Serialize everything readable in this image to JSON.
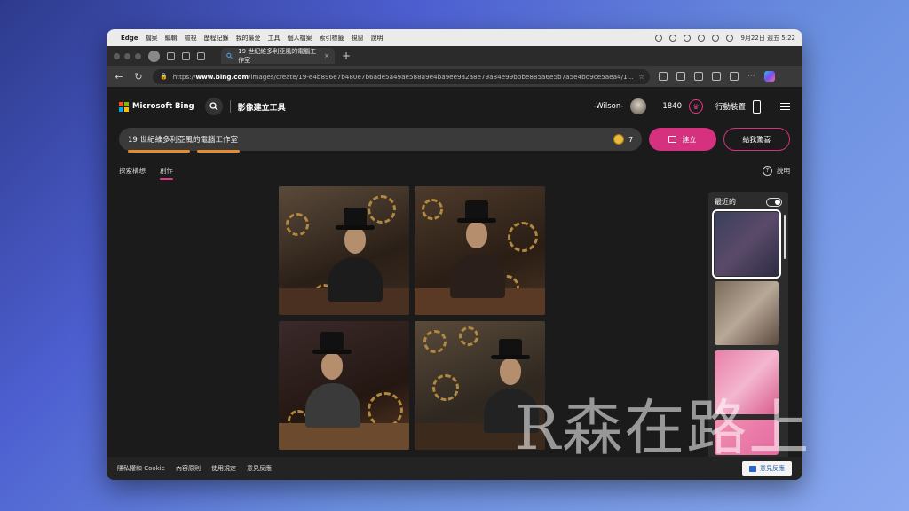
{
  "menubar": {
    "app_name": "Edge",
    "items": [
      "檔案",
      "編輯",
      "檢視",
      "歷程記錄",
      "我的最愛",
      "工具",
      "個人檔案",
      "索引標籤",
      "視窗",
      "說明"
    ],
    "clock": "9月22日 週五 5:22"
  },
  "tab": {
    "title": "19 世紀維多利亞風的電腦工作室"
  },
  "address": {
    "url_prefix": "https://",
    "url_host": "www.bing.com",
    "url_path": "/images/create/19-e4b896e7b480e7b6ade5a49ae588a9e4ba9ee9a2a8e79a84e99bbbe885a6e5b7a5e4bd9ce5aea4/1..."
  },
  "header": {
    "brand": "Microsoft Bing",
    "tool_title": "影像建立工具",
    "username": "-Wilson-",
    "points": "1840",
    "mobile_label": "行動裝置"
  },
  "prompt": {
    "text": "19 世紀維多利亞風的電腦工作室",
    "boosts": "7",
    "create_label": "建立",
    "surprise_label": "給我驚喜"
  },
  "subtabs": {
    "explore": "探索構想",
    "create": "創作",
    "help": "說明"
  },
  "recent": {
    "title": "最近的"
  },
  "footer": {
    "links": [
      "隱私權和 Cookie",
      "內容原則",
      "使用規定",
      "意見反應"
    ],
    "feedback_button": "意見反應"
  },
  "watermark": "R森在路上",
  "colors": {
    "accent_pink": "#d6317f",
    "underline_orange": "#e98a2b",
    "page_bg": "#1b1b1b"
  }
}
